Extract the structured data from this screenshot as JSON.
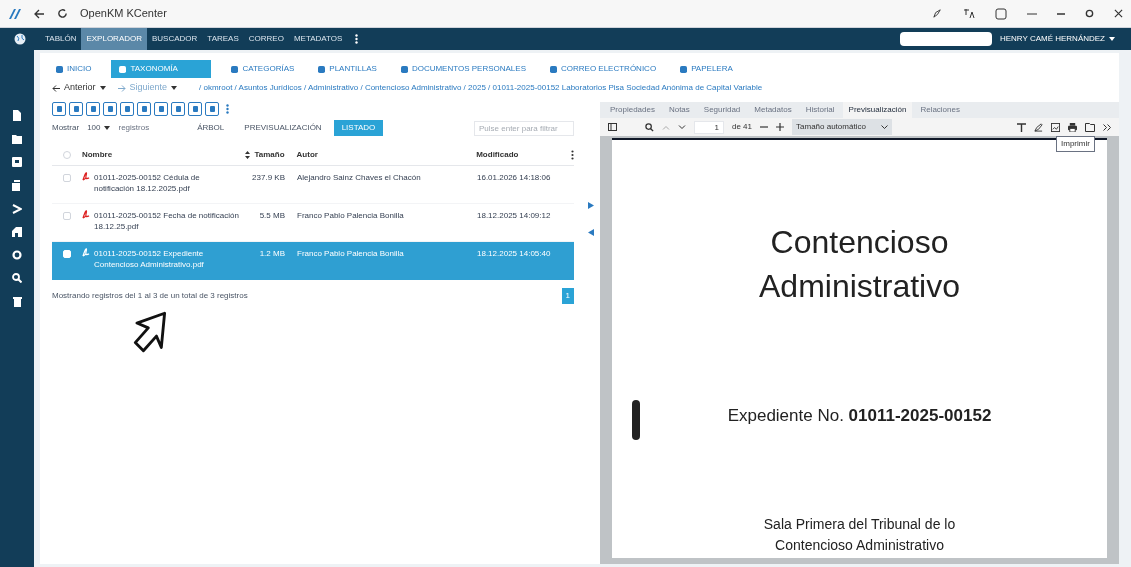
{
  "window": {
    "title": "OpenKM KCenter"
  },
  "nav": [
    {
      "label": "TABLÓN",
      "selected": false
    },
    {
      "label": "EXPLORADOR",
      "selected": true
    },
    {
      "label": "BUSCADOR",
      "selected": false
    },
    {
      "label": "TAREAS",
      "selected": false
    },
    {
      "label": "CORREO",
      "selected": false
    },
    {
      "label": "METADATOS",
      "selected": false
    }
  ],
  "user": "HENRY CAMÉ HERNÁNDEZ",
  "places": [
    {
      "label": "INICIO",
      "selected": false
    },
    {
      "label": "TAXONOMÍA",
      "selected": true
    },
    {
      "label": "CATEGORÍAS",
      "selected": false
    },
    {
      "label": "PLANTILLAS",
      "selected": false
    },
    {
      "label": "DOCUMENTOS PERSONALES",
      "selected": false
    },
    {
      "label": "CORREO ELECTRÓNICO",
      "selected": false
    },
    {
      "label": "PAPELERA",
      "selected": false
    }
  ],
  "back": "Anterior",
  "forward": "Siguiente",
  "breadcrumb": "/ okmroot / Asuntos Jurídicos / Administrativo / Contencioso Administrativo / 2025 / 01011-2025-00152 Laboratorios Pisa Sociedad Anónima de Capital Variable",
  "show": {
    "label": "Mostrar",
    "count": "100",
    "suffix": "registros"
  },
  "views": [
    {
      "label": "ÁRBOL",
      "selected": false
    },
    {
      "label": "PREVISUALIZACIÓN",
      "selected": false
    },
    {
      "label": "LISTADO",
      "selected": true
    }
  ],
  "filter": {
    "placeholder": "Pulse enter para filtrar"
  },
  "table": {
    "all_checked": false,
    "columns": [
      "Nombre",
      "Tamaño",
      "Autor",
      "Modificado"
    ],
    "rows": [
      {
        "name": "01011-2025-00152 Cédula de notificación 18.12.2025.pdf",
        "size": "237.9 KB",
        "author": "Alejandro Sainz Chaves el Chacón",
        "modified": "16.01.2026 14:18:06",
        "selected": false,
        "checked": false
      },
      {
        "name": "01011-2025-00152 Fecha de notificación 18.12.25.pdf",
        "size": "5.5 MB",
        "author": "Franco Pablo Palencia Bonilla",
        "modified": "18.12.2025 14:09:12",
        "selected": false,
        "checked": false
      },
      {
        "name": "01011-2025-00152 Expediente Contencioso Administrativo.pdf",
        "size": "1.2 MB",
        "author": "Franco Pablo Palencia Bonilla",
        "modified": "18.12.2025 14:05:40",
        "selected": true,
        "checked": false
      }
    ]
  },
  "footer": "Mostrando registros del 1 al 3 de un total de 3 registros",
  "page": "1",
  "tabs": [
    {
      "label": "Propiedades",
      "selected": false
    },
    {
      "label": "Notas",
      "selected": false
    },
    {
      "label": "Seguridad",
      "selected": false
    },
    {
      "label": "Metadatos",
      "selected": false
    },
    {
      "label": "Historial",
      "selected": false
    },
    {
      "label": "Previsualización",
      "selected": true
    },
    {
      "label": "Relaciones",
      "selected": false
    }
  ],
  "viewer": {
    "page": "1",
    "of": "de 41",
    "zoom": "Tamaño automático",
    "tooltip": "Imprimir",
    "lines": [
      {
        "kind": "title",
        "text": "Contencioso"
      },
      {
        "kind": "title",
        "text": "Administrativo"
      },
      {
        "kind": "case",
        "text": "Expediente No. **01011-2025-00152**"
      },
      {
        "kind": "small",
        "text": "Sala Primera del Tribunal de lo"
      },
      {
        "kind": "small",
        "text": "Contencioso Administrativo"
      }
    ]
  }
}
